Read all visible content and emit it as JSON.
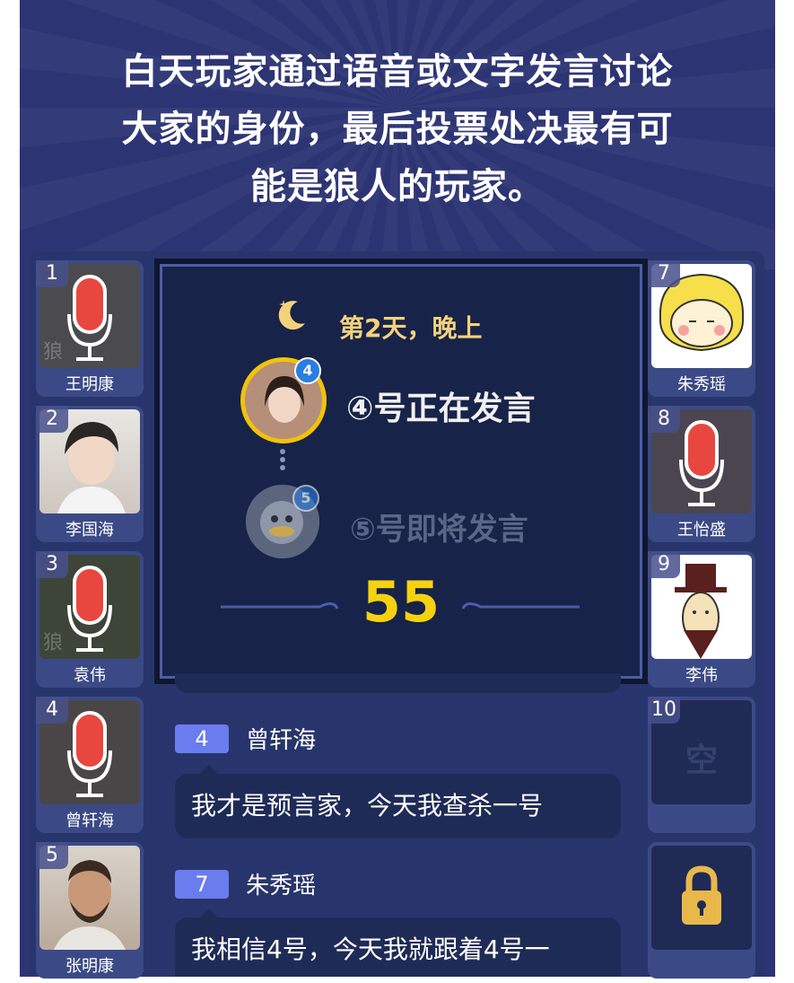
{
  "headline": [
    "白天玩家通过语音或文字发言讨论",
    "大家的身份，最后投票处决最有可",
    "能是狼人的玩家。"
  ],
  "left_seats": [
    {
      "num": "1",
      "name": "王明康",
      "state": "mic",
      "wolf": "狼"
    },
    {
      "num": "2",
      "name": "李国海",
      "state": "photo"
    },
    {
      "num": "3",
      "name": "袁伟",
      "state": "mic",
      "wolf": "狼"
    },
    {
      "num": "4",
      "name": "曾轩海",
      "state": "mic"
    },
    {
      "num": "5",
      "name": "张明康",
      "state": "photo"
    }
  ],
  "right_seats": [
    {
      "num": "7",
      "name": "朱秀瑶",
      "state": "cartoon"
    },
    {
      "num": "8",
      "name": "王怡盛",
      "state": "mic"
    },
    {
      "num": "9",
      "name": "李伟",
      "state": "cartoon"
    },
    {
      "num": "10",
      "name": "",
      "state": "empty",
      "empty_label": "空"
    },
    {
      "num": "",
      "name": "",
      "state": "locked"
    }
  ],
  "panel": {
    "day_label": "第2天，晚上",
    "speaking": "④号正在发言",
    "speaking_badge": "4",
    "upcoming": "⑤号即将发言",
    "upcoming_badge": "5",
    "timer": "55"
  },
  "chat": [
    {
      "num": "4",
      "sender": "曾轩海",
      "text": "我才是预言家，今天我查杀一号"
    },
    {
      "num": "7",
      "sender": "朱秀瑶",
      "text": "我相信4号，今天我就跟着4号一"
    }
  ],
  "colors": {
    "accent": "#f5d20f",
    "mic_red": "#e8473f",
    "badge_blue": "#2a7de1"
  }
}
